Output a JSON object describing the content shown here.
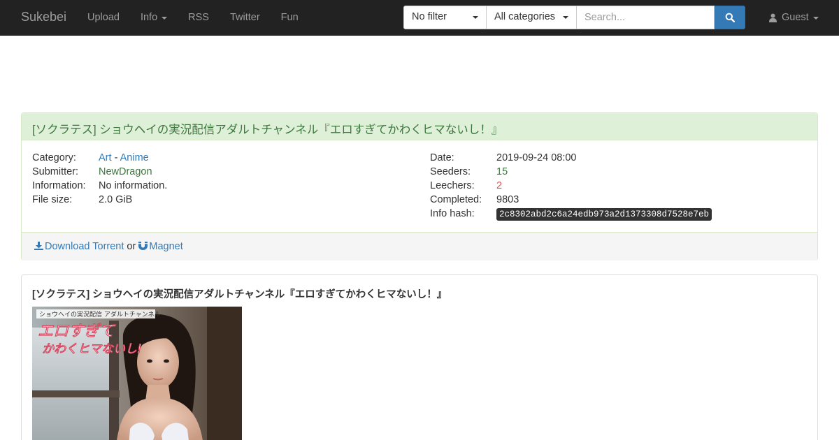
{
  "navbar": {
    "brand": "Sukebei",
    "links": [
      {
        "label": "Upload",
        "dropdown": false
      },
      {
        "label": "Info",
        "dropdown": true
      },
      {
        "label": "RSS",
        "dropdown": false
      },
      {
        "label": "Twitter",
        "dropdown": false
      },
      {
        "label": "Fun",
        "dropdown": false
      }
    ],
    "filter_selected": "No filter",
    "category_selected": "All categories",
    "search_placeholder": "Search...",
    "search_icon": "search-icon",
    "user_label": "Guest",
    "user_icon": "user-icon"
  },
  "torrent": {
    "title": "[ソクラテス] ショウヘイの実況配信アダルトチャンネル『エロすぎてかわくヒマないし！』",
    "labels": {
      "category": "Category:",
      "submitter": "Submitter:",
      "information": "Information:",
      "file_size": "File size:",
      "date": "Date:",
      "seeders": "Seeders:",
      "leechers": "Leechers:",
      "completed": "Completed:",
      "info_hash": "Info hash:"
    },
    "category_main": "Art",
    "category_separator": "-",
    "category_sub": "Anime",
    "submitter": "NewDragon",
    "information": "No information.",
    "file_size": "2.0 GiB",
    "date": "2019-09-24 08:00",
    "seeders": "15",
    "leechers": "2",
    "completed": "9803",
    "info_hash": "2c8302abd2c6a24edb973a2d1373308d7528e7eb",
    "download_label": "Download Torrent",
    "or_text": "or",
    "magnet_label": "Magnet",
    "colors": {
      "heading_bg": "#dff0d8",
      "seeders": "#3c763d",
      "leechers": "#d9534f",
      "link": "#337ab7"
    }
  },
  "description": {
    "title": "[ソクラテス] ショウヘイの実況配信アダルトチャンネル『エロすぎてかわくヒマないし！』",
    "cover_top_text": "ショウヘイの実況配信 アダルトチャンネル",
    "cover_main_text_1": "エロすぎて",
    "cover_main_text_2": "かわくヒマないし!"
  }
}
